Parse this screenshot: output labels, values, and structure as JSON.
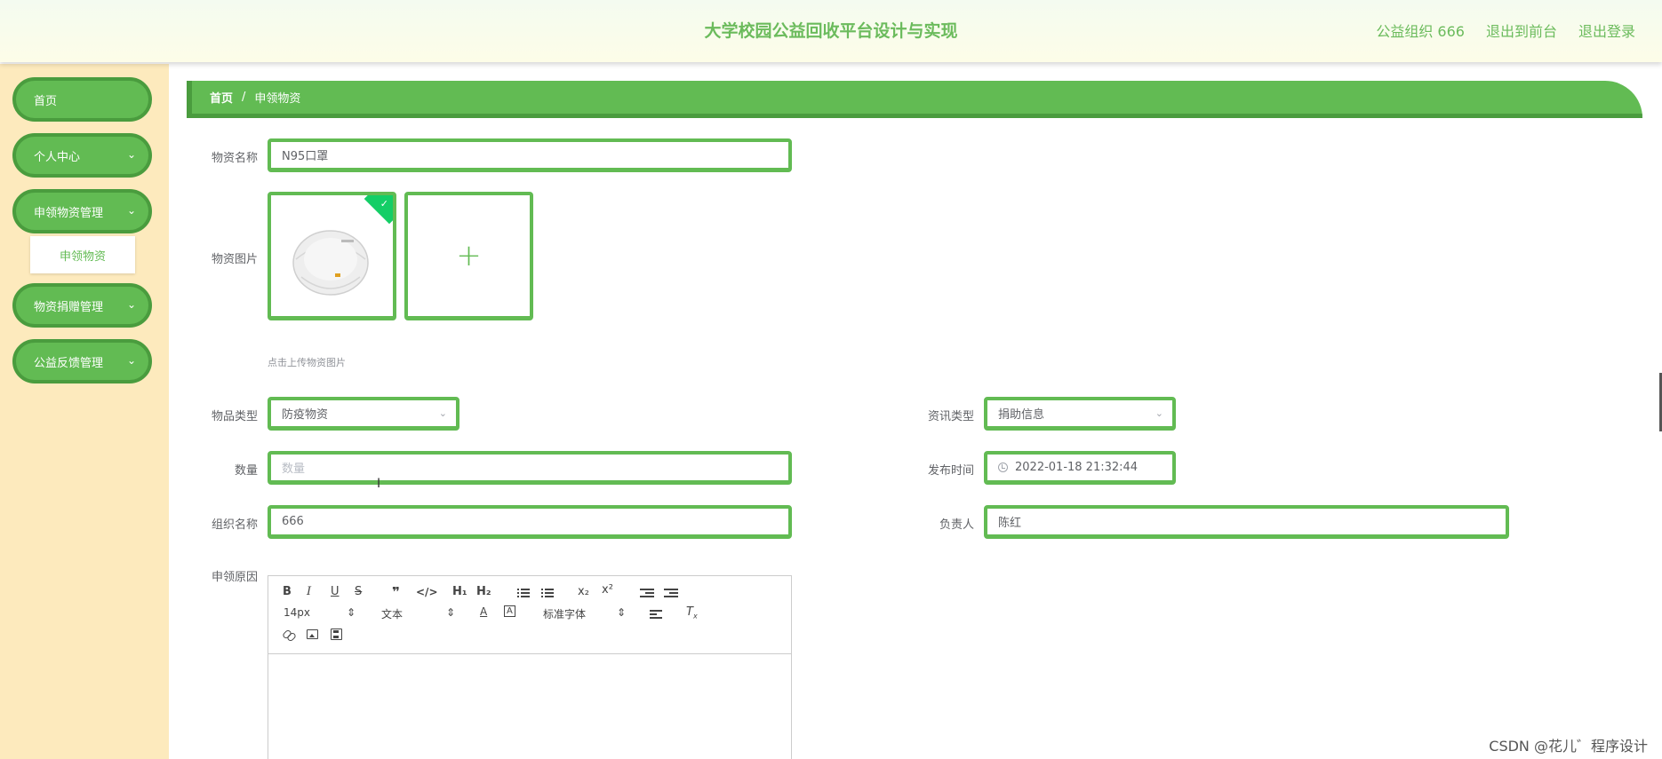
{
  "header": {
    "title": "大学校园公益回收平台设计与实现",
    "org": "公益组织 666",
    "to_front": "退出到前台",
    "logout": "退出登录"
  },
  "sidebar": {
    "items": [
      {
        "label": "首页"
      },
      {
        "label": "个人中心"
      },
      {
        "label": "申领物资管理"
      },
      {
        "label": "物资捐赠管理"
      },
      {
        "label": "公益反馈管理"
      }
    ],
    "sub_item": "申领物资"
  },
  "breadcrumb": {
    "home": "首页",
    "sep": "/",
    "current": "申领物资"
  },
  "form": {
    "name_label": "物资名称",
    "name_value": "N95口罩",
    "image_label": "物资图片",
    "upload_hint": "点击上传物资图片",
    "category_label": "物品类型",
    "category_value": "防疫物资",
    "info_type_label": "资讯类型",
    "info_type_value": "捐助信息",
    "quantity_label": "数量",
    "quantity_placeholder": "数量",
    "publish_time_label": "发布时间",
    "publish_time_value": "2022-01-18 21:32:44",
    "org_label": "组织名称",
    "org_value": "666",
    "owner_label": "负责人",
    "owner_value": "陈红",
    "reason_label": "申领原因"
  },
  "editor": {
    "h1": "H₁",
    "h2": "H₂",
    "sub": "x₂",
    "sup": "x²",
    "size": "14px",
    "format": "文本",
    "font": "标准字体"
  },
  "watermark": "CSDN @花儿゛程序设计",
  "colors": {
    "accent": "#62bb53",
    "accent_dark": "#4a9c3e",
    "sidebar_bg": "#fdeabd",
    "title": "#6bbb5c"
  }
}
